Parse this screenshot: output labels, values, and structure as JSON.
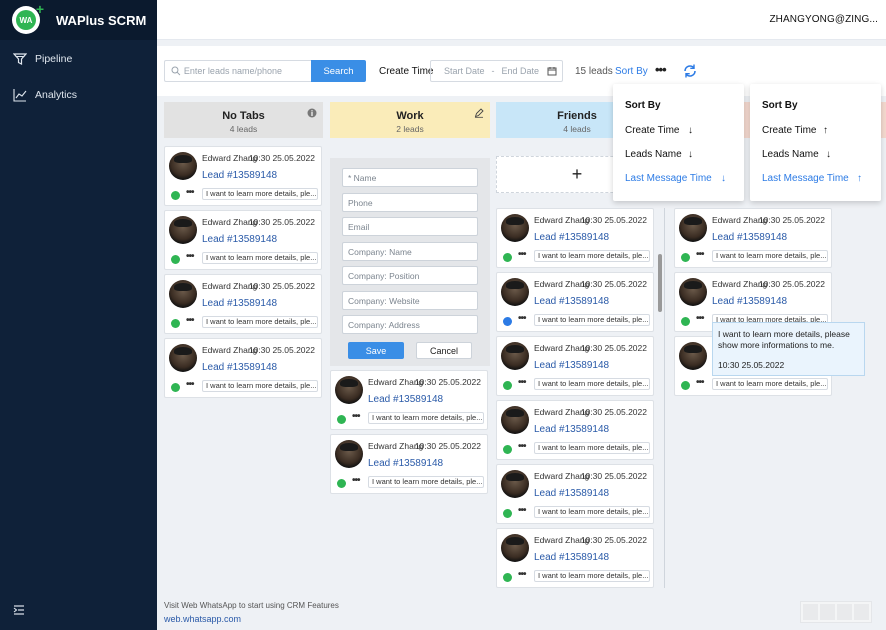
{
  "app": {
    "title": "WAPlus SCRM",
    "logo_text": "WA"
  },
  "sidebar": {
    "items": [
      {
        "label": "Pipeline"
      },
      {
        "label": "Analytics"
      }
    ]
  },
  "header": {
    "user": "ZHANGYONG@ZING..."
  },
  "toolbar": {
    "search_placeholder": "Enter leads name/phone",
    "search_label": "Search",
    "create_time_label": "Create Time",
    "start_date_placeholder": "Start Date",
    "date_separator": "-",
    "end_date_placeholder": "End Date",
    "leads_count": "15 leads",
    "sort_by_label": "Sort By",
    "more_label": "•••"
  },
  "columns": [
    {
      "name": "No Tabs",
      "count": "4 leads",
      "color": "#e2e2e2"
    },
    {
      "name": "Work",
      "count": "2 leads",
      "color": "#faecb9"
    },
    {
      "name": "Friends",
      "count": "4 leads",
      "color": "#c8e6f8"
    }
  ],
  "card": {
    "name": "Edward Zhang",
    "time": "10:30 25.05.2022",
    "lead": "Lead #13589148",
    "more": "•••",
    "message": "I want to learn more details, ple..."
  },
  "form": {
    "name_placeholder": "* Name",
    "phone_placeholder": "Phone",
    "email_placeholder": "Email",
    "company_name_placeholder": "Company: Name",
    "company_position_placeholder": "Company: Position",
    "company_website_placeholder": "Company: Website",
    "company_address_placeholder": "Company: Address",
    "save_label": "Save",
    "cancel_label": "Cancel"
  },
  "add_lead": {
    "label": "+"
  },
  "sort_menus": [
    {
      "title": "Sort By",
      "items": [
        {
          "label": "Create Time",
          "arrow": "↓"
        },
        {
          "label": "Leads Name",
          "arrow": "↓"
        },
        {
          "label": "Last Message Time",
          "arrow": "↓"
        }
      ]
    },
    {
      "title": "Sort By",
      "items": [
        {
          "label": "Create Time",
          "arrow": "↑"
        },
        {
          "label": "Leads Name",
          "arrow": "↓"
        },
        {
          "label": "Last Message Time",
          "arrow": "↑"
        }
      ]
    }
  ],
  "tooltip": {
    "text": "I want to learn more details, please show more informations to me.",
    "time": "10:30 25.05.2022"
  },
  "footer": {
    "text": "Visit Web WhatsApp to start using CRM Features",
    "link": "web.whatsapp.com"
  },
  "colors": {
    "accent": "#3a8ee6",
    "sidebar": "#0f2139",
    "whatsapp": "#2fb553"
  }
}
